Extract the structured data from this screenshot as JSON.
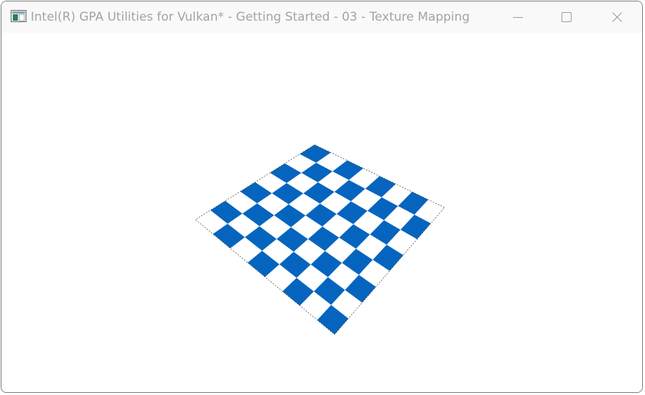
{
  "window": {
    "title": "Intel(R) GPA Utilities for Vulkan* - Getting Started - 03 - Texture Mapping",
    "app_icon": "app-window-icon",
    "controls": {
      "minimize_icon": "minimize-icon",
      "maximize_icon": "maximize-icon",
      "close_icon": "close-icon"
    }
  },
  "scene": {
    "description_type": "rendered-3d-viewport",
    "checkerboard": {
      "rows": 8,
      "cols": 8,
      "color_a": "#0565be",
      "color_b": "#ffffff"
    }
  }
}
